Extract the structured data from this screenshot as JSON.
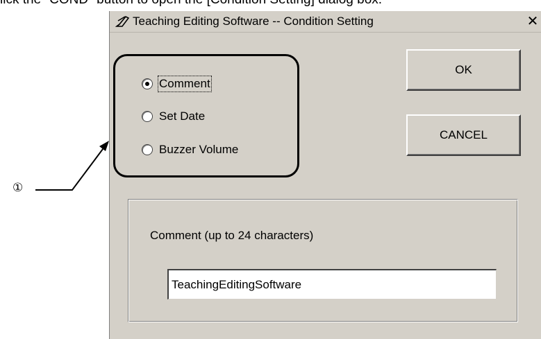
{
  "instruction": {
    "text": "lick the \"COND\" button to open the [Condition Setting] dialog box."
  },
  "dialog": {
    "title": "Teaching Editing Software -- Condition Setting",
    "title_icon": "pen-icon",
    "close_label": "✕",
    "radio_options": [
      {
        "label": "Comment",
        "checked": true
      },
      {
        "label": "Set Date",
        "checked": false
      },
      {
        "label": "Buzzer Volume",
        "checked": false
      }
    ],
    "ok_label": "OK",
    "cancel_label": "CANCEL",
    "comment_label": "Comment (up to 24 characters)",
    "comment_value": "TeachingEditingSoftware"
  },
  "callout": {
    "label": "①"
  }
}
